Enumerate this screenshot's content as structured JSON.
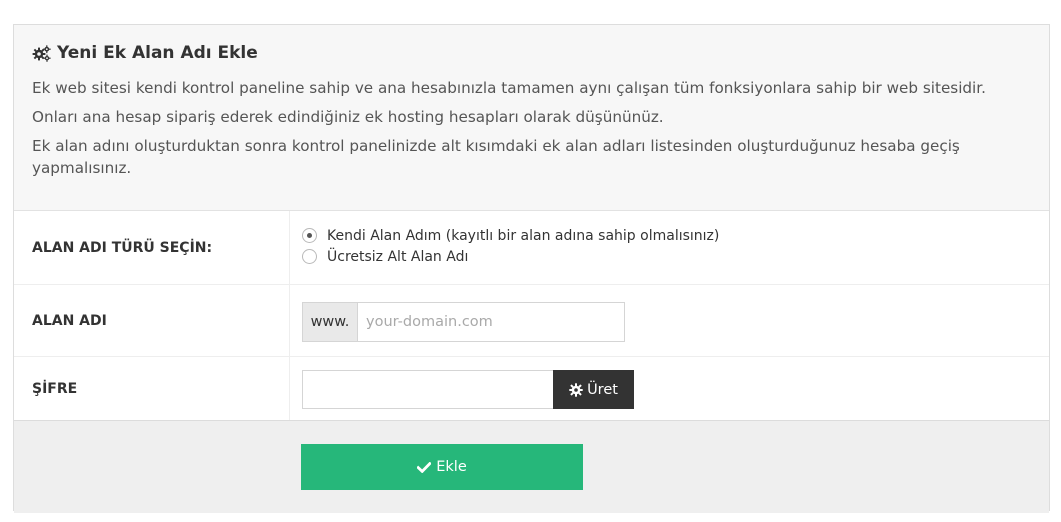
{
  "panel": {
    "title": "Yeni Ek Alan Adı Ekle",
    "title_icon": "gears-icon",
    "description": [
      "Ek web sitesi kendi kontrol paneline sahip ve ana hesabınızla tamamen aynı çalışan tüm fonksiyonlara sahip bir web sitesidir.",
      "Onları ana hesap sipariş ederek edindiğiniz ek hosting hesapları olarak düşününüz.",
      "Ek alan adını oluşturduktan sonra kontrol panelinizde alt kısımdaki ek alan adları listesinden oluşturduğunuz hesaba geçiş yapmalısınız."
    ]
  },
  "form": {
    "domain_type": {
      "label": "ALAN ADI TÜRÜ SEÇİN:",
      "options": [
        {
          "label": "Kendi Alan Adım (kayıtlı bir alan adına sahip olmalısınız)",
          "selected": true
        },
        {
          "label": "Ücretsiz Alt Alan Adı",
          "selected": false
        }
      ]
    },
    "domain": {
      "label": "ALAN ADI",
      "prefix": "www.",
      "value": "",
      "placeholder": "your-domain.com"
    },
    "password": {
      "label": "ŞİFRE",
      "value": "",
      "generate_label": "Üret",
      "generate_icon": "gear-icon"
    },
    "submit": {
      "label": "Ekle",
      "icon": "check-icon"
    }
  },
  "colors": {
    "submit_bg": "#26b77a",
    "generate_bg": "#333333",
    "header_bg": "#f7f7f7",
    "footer_bg": "#efefef"
  }
}
